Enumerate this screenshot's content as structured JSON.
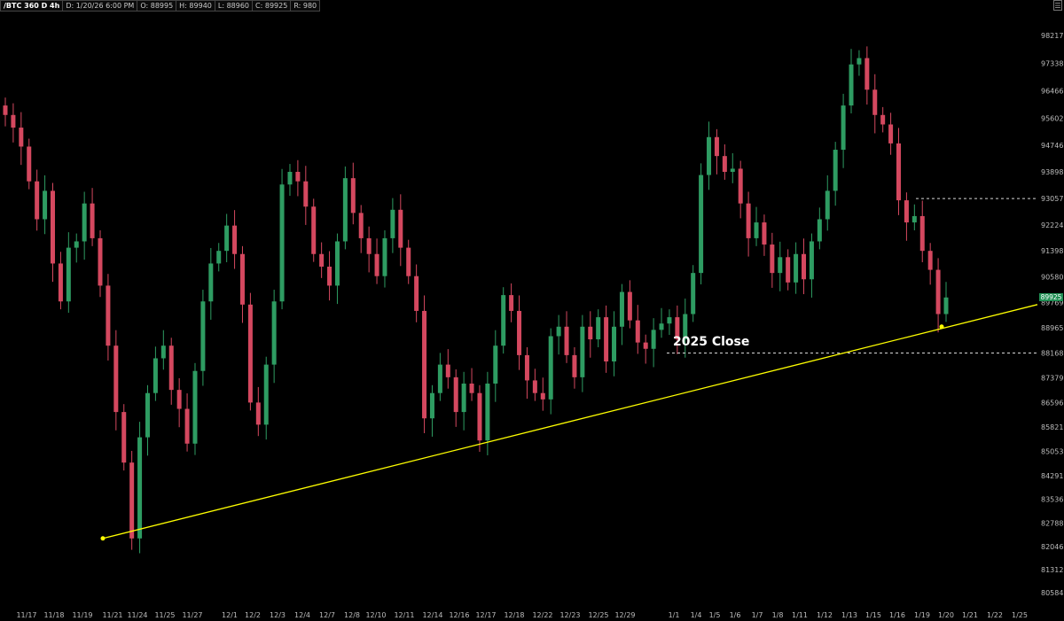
{
  "header": {
    "symbol": "/BTC 360 D 4h",
    "date": "D: 1/20/26 6:00 PM",
    "open": "O: 88995",
    "high": "H: 89940",
    "low": "L: 88960",
    "close": "C: 89925",
    "range": "R: 980"
  },
  "colors": {
    "up": "#2e9c62",
    "down": "#d4485f",
    "trendline": "#ffff00",
    "background": "#000000",
    "price_box": "#1f8f53"
  },
  "icons": {
    "corner": "chart-settings-icon"
  },
  "chart_data": {
    "type": "candlestick",
    "title": "",
    "xlabel": "",
    "ylabel": "",
    "ylim": [
      80200,
      98700
    ],
    "y_ticks": [
      "98217",
      "97338",
      "96466",
      "95602",
      "94746",
      "93898",
      "93057",
      "92224",
      "91398",
      "90580",
      "89769",
      "88965",
      "88168",
      "87379",
      "86596",
      "85821",
      "85053",
      "84291",
      "83536",
      "82788",
      "82046",
      "81312",
      "80584"
    ],
    "x_ticks": [
      "11/17",
      "11/18",
      "11/19",
      "11/21",
      "11/24",
      "11/25",
      "11/27",
      "12/1",
      "12/2",
      "12/3",
      "12/4",
      "12/7",
      "12/8",
      "12/10",
      "12/11",
      "12/14",
      "12/16",
      "12/17",
      "12/18",
      "12/22",
      "12/23",
      "12/25",
      "12/29",
      "1/1",
      "1/4",
      "1/5",
      "1/6",
      "1/7",
      "1/8",
      "1/11",
      "1/12",
      "1/13",
      "1/15",
      "1/16",
      "1/19",
      "1/20",
      "1/21",
      "1/22",
      "1/25"
    ],
    "close_series": [
      95700,
      95300,
      94700,
      93600,
      92400,
      93300,
      91000,
      89800,
      91500,
      91700,
      92900,
      91800,
      90300,
      88400,
      86300,
      84700,
      82300,
      85500,
      86900,
      88000,
      88400,
      87000,
      86400,
      85300,
      87600,
      89800,
      91000,
      91400,
      92200,
      91300,
      89700,
      86600,
      85900,
      87800,
      89800,
      93500,
      93900,
      93600,
      92800,
      91300,
      90900,
      90300,
      91700,
      93700,
      92600,
      91800,
      91300,
      90600,
      91800,
      92700,
      91500,
      90600,
      89500,
      86100,
      86900,
      87800,
      87400,
      86300,
      87200,
      86900,
      85400,
      87200,
      88400,
      90000,
      89500,
      88100,
      87300,
      86900,
      86700,
      88700,
      89000,
      88100,
      87400,
      89000,
      88600,
      89300,
      87900,
      89000,
      90100,
      89200,
      88500,
      88300,
      88900,
      89100,
      89300,
      88600,
      89400,
      90700,
      93800,
      95000,
      94400,
      93900,
      94000,
      92900,
      91800,
      92300,
      91600,
      90700,
      91200,
      90400,
      91300,
      90500,
      91700,
      92400,
      93300,
      94600,
      96000,
      97300,
      97500,
      96500,
      95700,
      95400,
      94800,
      93000,
      92300,
      92500,
      91400,
      90800,
      89400,
      89925
    ],
    "last_price": "89925",
    "annotations": [
      {
        "text": "2025 Close",
        "price": 88168
      }
    ],
    "reference_lines": [
      {
        "price": 93057
      },
      {
        "price": 88168
      }
    ],
    "trendline": {
      "from": {
        "date": "11/21",
        "price": 82300
      },
      "to": {
        "date": "1/25",
        "price": 89700
      }
    }
  }
}
